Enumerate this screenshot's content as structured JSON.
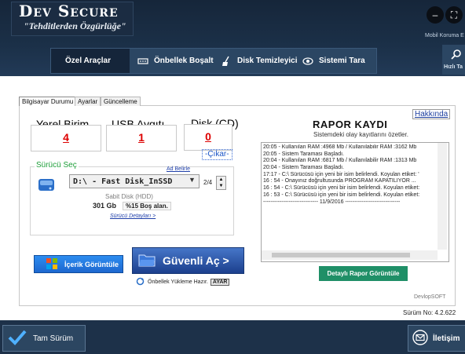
{
  "header": {
    "title": "Dev Secure",
    "subtitle": "\"Tehditlerden Özgürlüğe\"",
    "mobile_label": "Mobil Koruma E",
    "quick_label": "Hızlı Ta"
  },
  "nav": {
    "items": [
      {
        "label": "Özel Araçlar",
        "icon": "tools-icon"
      },
      {
        "label": "Önbellek Boşalt",
        "icon": "ram-icon"
      },
      {
        "label": "Disk Temizleyici",
        "icon": "broom-icon"
      },
      {
        "label": "Sistemi Tara",
        "icon": "eye-icon"
      }
    ]
  },
  "tabs": [
    "Bilgisayar Durumu",
    "Ayarlar",
    "Güncelleme"
  ],
  "stats": {
    "local": {
      "label": "Yerel Birim",
      "value": "4"
    },
    "usb": {
      "label": "USB Aygıtı",
      "value": "1"
    },
    "cd": {
      "label": "Disk (CD)",
      "value": "0"
    },
    "eject_label": "-Çıkar-"
  },
  "drive": {
    "group_label": "Sürücü Seç",
    "rename_link": "Ad Belirle",
    "selected": "D:\\ - Fast Disk_InSSD",
    "page": "2/4",
    "type": "Sabit Disk (HDD)",
    "size": "301 Gb",
    "free": "%15 Boş alan.",
    "details_link": "Sürücü Detayları >"
  },
  "actions": {
    "view_contents": "İçerik Görüntüle",
    "safe_open": "Güvenli Aç >",
    "cache_status": "Önbellek Yükleme Hazır.",
    "settings_btn": "AYAR"
  },
  "report": {
    "about_link": "Hakkında",
    "title": "RAPOR KAYDI",
    "subtitle": "Sistemdeki olay kayıtlarını özetler.",
    "log": [
      "20:05 - Kullanılan RAM :4968 Mb  /  Kullanılabilir RAM :3162 Mb",
      "20:05 - Sistem Taraması Başladı.",
      "20:04 - Kullanılan RAM :6817 Mb  /  Kullanılabilir RAM :1313 Mb",
      "20:04 - Sistem Taraması Başladı.",
      "17:17 - C:\\ Sürücüsü için yeni bir isim belirlendi. Koyulan etiket: '",
      "16 : 54 - Onayınız doğrultusunda PROGRAM KAPATILIYOR ...",
      "16 : 54 - C:\\ Sürücüsü için yeni bir isim belirlendi. Koyulan etiket:",
      "16 : 53 - C:\\ Sürücüsü için yeni bir isim belirlendi. Koyulan etiket:",
      "------------------------------ 11/9/2016 ------------------------------"
    ],
    "detail_button": "Detaylı Rapor Görüntüle",
    "brand": "DevlopSOFT",
    "version": "Sürüm No: 4.2.622"
  },
  "bottom": {
    "full_version": "Tam Sürüm",
    "contact": "İletişim"
  },
  "colors": {
    "header_bg": "#1b3048",
    "accent_green": "#1f8f67",
    "stat_red": "#dd0000"
  }
}
